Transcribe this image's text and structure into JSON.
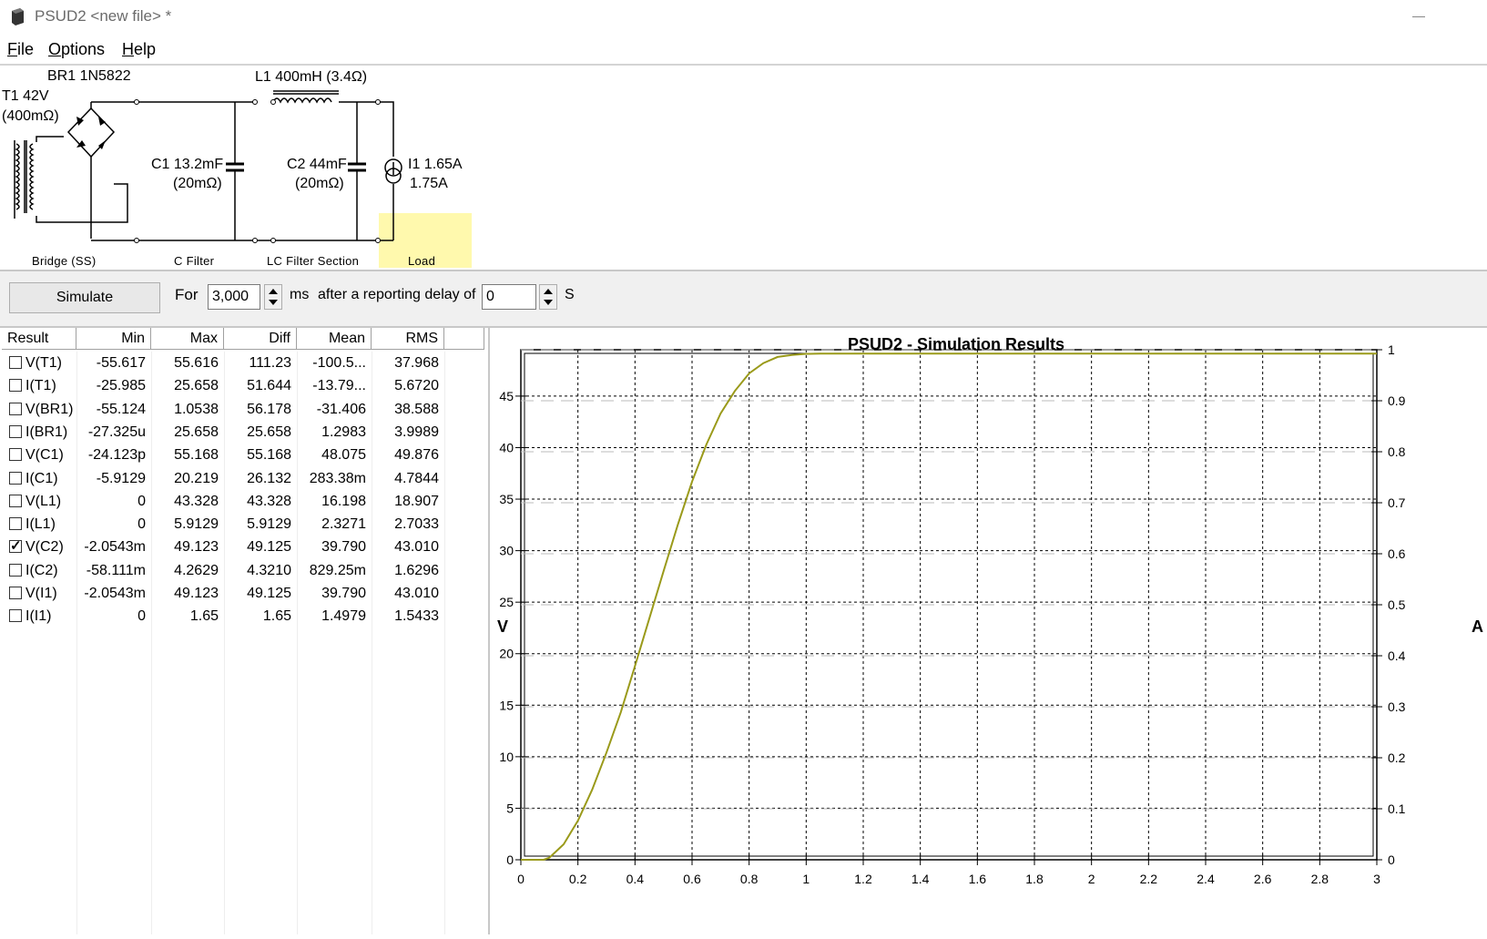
{
  "window": {
    "title": "PSUD2  <new file> *",
    "icon": "app-icon"
  },
  "menu": [
    {
      "u": "F",
      "rest": "ile"
    },
    {
      "u": "O",
      "rest": "ptions"
    },
    {
      "u": "H",
      "rest": "elp"
    }
  ],
  "schematic": {
    "transformer": "T1 42V",
    "transformer_res": "(400mΩ)",
    "bridge": "BR1 1N5822",
    "inductor": "L1 400mH (3.4Ω)",
    "c1": "C1 13.2mF",
    "c1_res": "(20mΩ)",
    "c2": "C2 44mF",
    "c2_res": "(20mΩ)",
    "load1": "I1 1.65A",
    "load2": "1.75A",
    "captions": {
      "bridge": "Bridge (SS)",
      "cfilter": "C Filter",
      "lc": "LC Filter Section",
      "load": "Load"
    },
    "load_highlight": "#fff9ad"
  },
  "controls": {
    "simulate": "Simulate",
    "for": "For",
    "duration": "3,000",
    "ms": "ms",
    "after": "after a reporting delay of",
    "delay": "0",
    "s": "S"
  },
  "table": {
    "headers": [
      "Result",
      "Min",
      "Max",
      "Diff",
      "Mean",
      "RMS"
    ],
    "rows": [
      {
        "name": "V(T1)",
        "checked": false,
        "min": "-55.617",
        "max": "55.616",
        "diff": "111.23",
        "mean": "-100.5...",
        "rms": "37.968"
      },
      {
        "name": "I(T1)",
        "checked": false,
        "min": "-25.985",
        "max": "25.658",
        "diff": "51.644",
        "mean": "-13.79...",
        "rms": "5.6720"
      },
      {
        "name": "V(BR1)",
        "checked": false,
        "min": "-55.124",
        "max": "1.0538",
        "diff": "56.178",
        "mean": "-31.406",
        "rms": "38.588"
      },
      {
        "name": "I(BR1)",
        "checked": false,
        "min": "-27.325u",
        "max": "25.658",
        "diff": "25.658",
        "mean": "1.2983",
        "rms": "3.9989"
      },
      {
        "name": "V(C1)",
        "checked": false,
        "min": "-24.123p",
        "max": "55.168",
        "diff": "55.168",
        "mean": "48.075",
        "rms": "49.876"
      },
      {
        "name": "I(C1)",
        "checked": false,
        "min": "-5.9129",
        "max": "20.219",
        "diff": "26.132",
        "mean": "283.38m",
        "rms": "4.7844"
      },
      {
        "name": "V(L1)",
        "checked": false,
        "min": "0",
        "max": "43.328",
        "diff": "43.328",
        "mean": "16.198",
        "rms": "18.907"
      },
      {
        "name": "I(L1)",
        "checked": false,
        "min": "0",
        "max": "5.9129",
        "diff": "5.9129",
        "mean": "2.3271",
        "rms": "2.7033"
      },
      {
        "name": "V(C2)",
        "checked": true,
        "min": "-2.0543m",
        "max": "49.123",
        "diff": "49.125",
        "mean": "39.790",
        "rms": "43.010"
      },
      {
        "name": "I(C2)",
        "checked": false,
        "min": "-58.111m",
        "max": "4.2629",
        "diff": "4.3210",
        "mean": "829.25m",
        "rms": "1.6296"
      },
      {
        "name": "V(I1)",
        "checked": false,
        "min": "-2.0543m",
        "max": "49.123",
        "diff": "49.125",
        "mean": "39.790",
        "rms": "43.010"
      },
      {
        "name": "I(I1)",
        "checked": false,
        "min": "0",
        "max": "1.65",
        "diff": "1.65",
        "mean": "1.4979",
        "rms": "1.5433"
      }
    ]
  },
  "chart_data": {
    "type": "line",
    "title": "PSUD2 - Simulation Results",
    "ylabel_left": "V",
    "ylabel_right": "A",
    "xlim": [
      0,
      3
    ],
    "ylim": [
      0,
      49.5
    ],
    "ylim_right": [
      0,
      1
    ],
    "x_ticks": [
      "0",
      "0.2",
      "0.4",
      "0.6",
      "0.8",
      "1",
      "1.2",
      "1.4",
      "1.6",
      "1.8",
      "2",
      "2.2",
      "2.4",
      "2.6",
      "2.8",
      "3"
    ],
    "y_ticks": [
      "0",
      "5",
      "10",
      "15",
      "20",
      "25",
      "30",
      "35",
      "40",
      "45"
    ],
    "y2_ticks": [
      "0",
      "0.1",
      "0.2",
      "0.3",
      "0.4",
      "0.5",
      "0.6",
      "0.7",
      "0.8",
      "0.9",
      "1"
    ],
    "grid": true,
    "line_color": "#9a9a1a",
    "series": [
      {
        "x": [
          0,
          0.08,
          0.1,
          0.15,
          0.2,
          0.25,
          0.3,
          0.35,
          0.4,
          0.45,
          0.5,
          0.55,
          0.6,
          0.65,
          0.7,
          0.75,
          0.8,
          0.85,
          0.9,
          0.95,
          1.0,
          1.05,
          1.1,
          1.5,
          2.0,
          2.5,
          3.0
        ],
        "y": [
          0,
          0,
          0.2,
          1.5,
          3.8,
          6.8,
          10.4,
          14.3,
          18.8,
          23.4,
          28.0,
          32.5,
          36.7,
          40.3,
          43.3,
          45.5,
          47.2,
          48.2,
          48.8,
          49.0,
          49.1,
          49.12,
          49.12,
          49.12,
          49.12,
          49.12,
          49.12
        ]
      }
    ]
  }
}
